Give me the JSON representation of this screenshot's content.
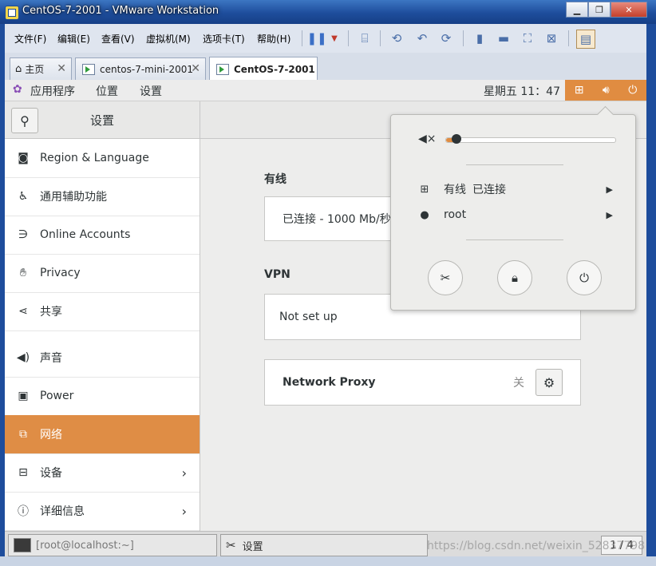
{
  "window": {
    "title": "CentOS-7-2001 - VMware Workstation"
  },
  "menubar": {
    "items": [
      "文件(F)",
      "编辑(E)",
      "查看(V)",
      "虚拟机(M)",
      "选项卡(T)",
      "帮助(H)"
    ]
  },
  "tabs": [
    {
      "label": "主页"
    },
    {
      "label": "centos-7-mini-2001"
    },
    {
      "label": "CentOS-7-2001"
    }
  ],
  "gnome_topbar": {
    "menus": [
      "应用程序",
      "位置",
      "设置"
    ],
    "clock": "星期五 11：47"
  },
  "settings": {
    "title": "设置",
    "sidebar": [
      {
        "label": "Region & Language",
        "icon": "camera-icon"
      },
      {
        "label": "通用辅助功能",
        "icon": "accessibility-icon"
      },
      {
        "label": "Online Accounts",
        "icon": "online-accounts-icon"
      },
      {
        "label": "Privacy",
        "icon": "hand-icon"
      },
      {
        "label": "共享",
        "icon": "share-icon"
      },
      {
        "label": "声音",
        "icon": "speaker-icon"
      },
      {
        "label": "Power",
        "icon": "power-plug-icon"
      },
      {
        "label": "网络",
        "icon": "network-icon",
        "selected": true
      },
      {
        "label": "设备",
        "icon": "devices-icon",
        "chevron": true
      },
      {
        "label": "详细信息",
        "icon": "info-icon",
        "chevron": true
      }
    ],
    "wired": {
      "heading": "有线",
      "status": "已连接 - 1000 Mb/秒"
    },
    "vpn": {
      "heading": "VPN",
      "status": "Not set up"
    },
    "proxy": {
      "label": "Network Proxy",
      "state": "关"
    }
  },
  "popover": {
    "volume_fraction": 0.06,
    "network": {
      "label": "有线",
      "status": "已连接"
    },
    "user": {
      "label": "root"
    }
  },
  "taskbar": {
    "items": [
      "[root@localhost:~]",
      "设置"
    ],
    "pager": "1 / 4"
  },
  "watermark": "https://blog.csdn.net/weixin_52837798",
  "colors": {
    "accent": "#df8d45",
    "vmware_title": "#1e4d9c"
  }
}
